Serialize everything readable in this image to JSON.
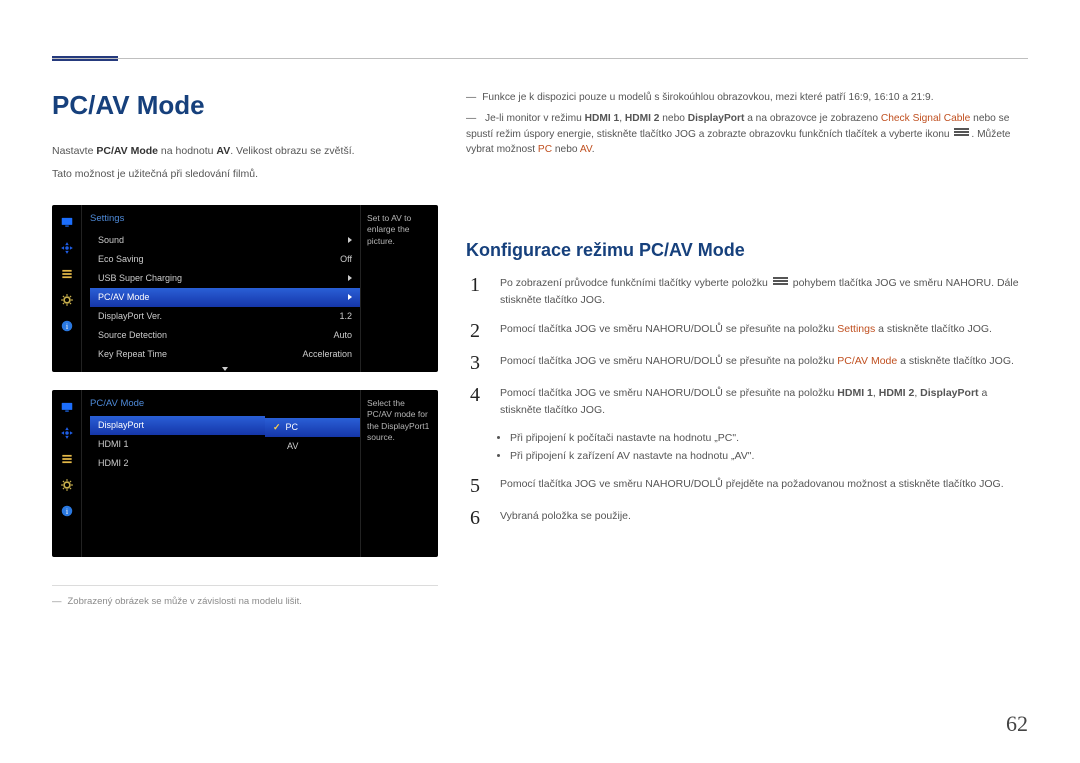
{
  "page": {
    "number": "62"
  },
  "left": {
    "title": "PC/AV Mode",
    "intro1_pre": "Nastavte ",
    "intro1_bold": "PC/AV Mode",
    "intro1_mid": " na hodnotu ",
    "intro1_bold2": "AV",
    "intro1_post": ". Velikost obrazu se zvětší.",
    "intro2": "Tato možnost je užitečná při sledování filmů.",
    "footnote": "Zobrazený obrázek se může v závislosti na modelu lišit.",
    "panel1": {
      "title": "Settings",
      "help": "Set to AV to enlarge the picture.",
      "rows": [
        {
          "label": "Sound",
          "value": "",
          "caret": true
        },
        {
          "label": "Eco Saving",
          "value": "Off"
        },
        {
          "label": "USB Super Charging",
          "value": "",
          "caret": true
        },
        {
          "label": "PC/AV Mode",
          "value": "",
          "caret": true,
          "hi": true
        },
        {
          "label": "DisplayPort Ver.",
          "value": "1.2"
        },
        {
          "label": "Source Detection",
          "value": "Auto"
        },
        {
          "label": "Key Repeat Time",
          "value": "Acceleration"
        }
      ]
    },
    "panel2": {
      "title": "PC/AV Mode",
      "help": "Select the PC/AV mode for the DisplayPort1 source.",
      "sources": [
        {
          "label": "DisplayPort",
          "hi": true
        },
        {
          "label": "HDMI 1"
        },
        {
          "label": "HDMI 2"
        }
      ],
      "modes": [
        {
          "label": "PC",
          "sel": true
        },
        {
          "label": "AV"
        }
      ]
    }
  },
  "right": {
    "note1": "Funkce je k dispozici pouze u modelů s širokoúhlou obrazovkou, mezi které patří 16:9, 16:10 a 21:9.",
    "note2_a": "Je-li monitor v režimu ",
    "note2_b1": "HDMI 1",
    "note2_b2": "HDMI 2",
    "note2_b3": "DisplayPort",
    "note2_mid": " a na obrazovce je zobrazeno ",
    "note2_accent": "Check Signal Cable",
    "note2_rest1": " nebo se spustí režim úspory energie, stiskněte tlačítko JOG a zobrazte obrazovku funkčních tlačítek a vyberte ikonu ",
    "note2_tail": ". Můžete vybrat možnost ",
    "note2_pc": "PC",
    "note2_or": " nebo ",
    "note2_av": "AV",
    "heading": "Konfigurace režimu PC/AV Mode",
    "step1a": "Po zobrazení průvodce funkčními tlačítky vyberte položku ",
    "step1b": " pohybem tlačítka JOG ve směru NAHORU. Dále stiskněte tlačítko JOG.",
    "step2a": "Pomocí tlačítka JOG ve směru NAHORU/DOLŮ se přesuňte na položku ",
    "step2_accent": "Settings",
    "step2b": " a stiskněte tlačítko JOG.",
    "step3a": "Pomocí tlačítka JOG ve směru NAHORU/DOLŮ se přesuňte na položku ",
    "step3_accent": "PC/AV Mode",
    "step3b": " a stiskněte tlačítko JOG.",
    "step4a": "Pomocí tlačítka JOG ve směru NAHORU/DOLŮ se přesuňte na položku ",
    "step4_b1": "HDMI 1",
    "step4_b2": "HDMI 2",
    "step4_b3": "DisplayPort",
    "step4b": " a stiskněte tlačítko JOG.",
    "bullet1": "Při připojení k počítači nastavte na hodnotu „PC\".",
    "bullet2": "Při připojení k zařízení AV nastavte na hodnotu „AV\".",
    "step5": "Pomocí tlačítka JOG ve směru NAHORU/DOLŮ přejděte na požadovanou možnost a stiskněte tlačítko JOG.",
    "step6": "Vybraná položka se použije."
  }
}
